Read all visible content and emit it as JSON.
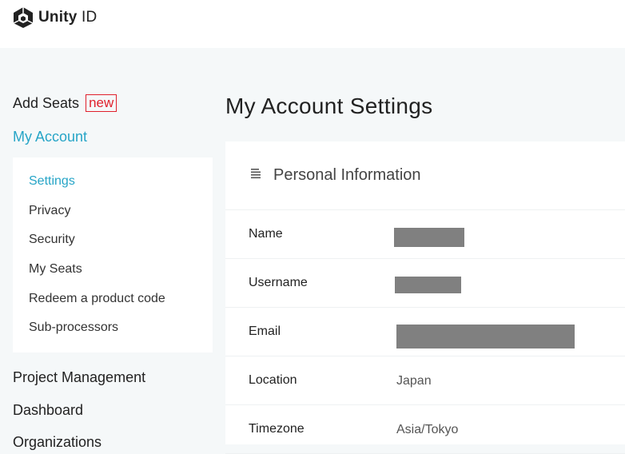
{
  "header": {
    "logo_bold": "Unity",
    "logo_light": " ID"
  },
  "sidebar": {
    "add_seats": "Add Seats",
    "new_badge": "new",
    "my_account": "My Account",
    "subnav": [
      {
        "label": "Settings",
        "active": true
      },
      {
        "label": "Privacy"
      },
      {
        "label": "Security"
      },
      {
        "label": "My Seats"
      },
      {
        "label": "Redeem a product code"
      },
      {
        "label": "Sub-processors"
      }
    ],
    "bottom": [
      {
        "label": "Project Management"
      },
      {
        "label": "Dashboard"
      },
      {
        "label": "Organizations"
      }
    ]
  },
  "main": {
    "title": "My Account Settings",
    "card": {
      "section_title": "Personal Information",
      "section_icon": "document-lines-icon",
      "rows": [
        {
          "label": "Name",
          "value": "",
          "redacted": true
        },
        {
          "label": "Username",
          "value": "",
          "redacted": true
        },
        {
          "label": "Email",
          "value": "",
          "redacted": true
        },
        {
          "label": "Location",
          "value": "Japan"
        },
        {
          "label": "Timezone",
          "value": "Asia/Tokyo"
        }
      ]
    }
  },
  "colors": {
    "accent": "#27a5c7",
    "badge_red": "#e0202c",
    "page_bg": "#f5f8f9",
    "redaction": "#808080"
  }
}
